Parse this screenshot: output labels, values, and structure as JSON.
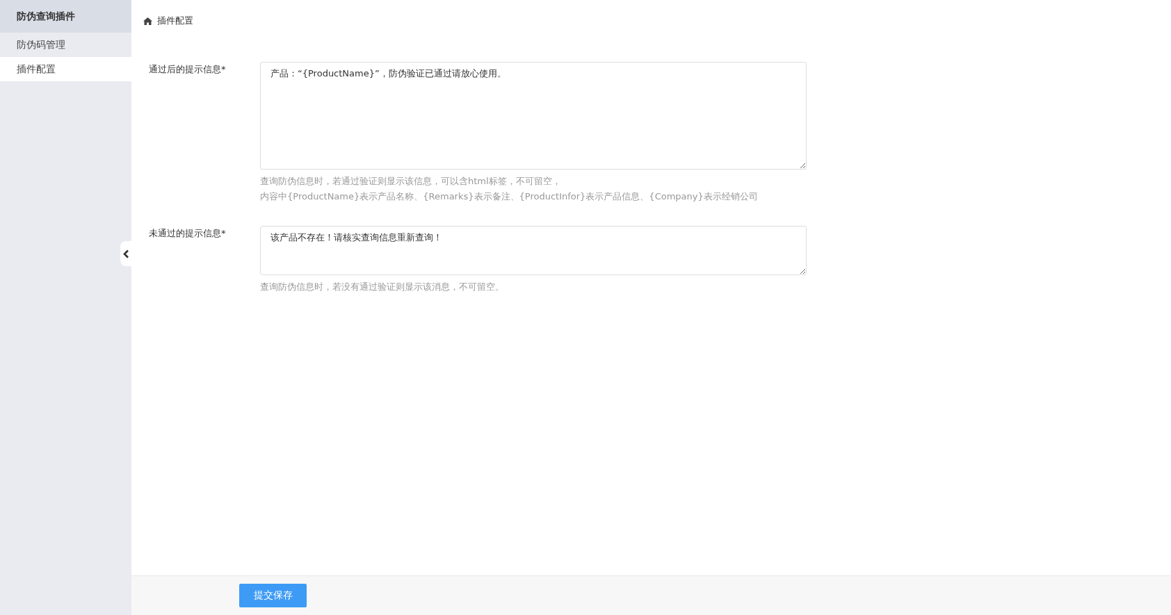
{
  "sidebar": {
    "title": "防伪查询插件",
    "items": [
      {
        "label": "防伪码管理",
        "selected": false
      },
      {
        "label": "插件配置",
        "selected": true
      }
    ]
  },
  "breadcrumb": {
    "label": "插件配置"
  },
  "fields": [
    {
      "label": "通过后的提示信息*",
      "value": "产品：“{ProductName}”，防伪验证已通过请放心使用。",
      "help": [
        "查询防伪信息时，若通过验证则显示该信息，可以含html标签，不可留空，",
        "内容中{ProductName}表示产品名称、{Remarks}表示备注、{ProductInfor}表示产品信息、{Company}表示经销公司"
      ]
    },
    {
      "label": "未通过的提示信息*",
      "value": "该产品不存在！请核实查询信息重新查询！",
      "help": [
        "查询防伪信息时，若没有通过验证则显示该消息，不可留空。"
      ]
    }
  ],
  "submit_button": "提交保存"
}
